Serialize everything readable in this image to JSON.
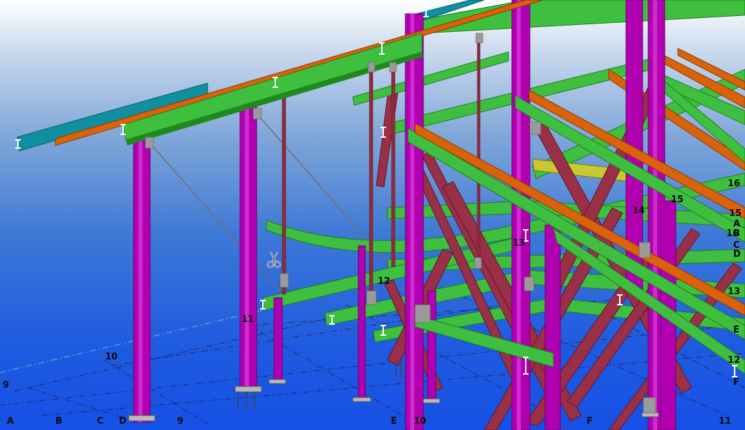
{
  "viewport": {
    "background_top": "#ffffff",
    "background_bottom": "#1650e6"
  },
  "colors": {
    "column": "#b000b0",
    "column_edge": "#6a006a",
    "beam": "#3fbf3f",
    "beam_edge": "#1e7a1e",
    "purlin": "#d9620a",
    "brace": "#9a2f48",
    "rod": "#8c2c3c",
    "teal": "#0f8fa0",
    "grid_line": "#1a1a40"
  },
  "icons": {
    "cursor": "scissors-icon"
  },
  "grid_labels": {
    "a_bottom": "A",
    "b_bottom": "B",
    "c_bottom": "C",
    "d_bottom": "D",
    "e_bottom": "E",
    "f_bottom": "F",
    "nine_left": "9",
    "nine_bottom": "9",
    "ten_mid": "10",
    "ten_bottom": "10",
    "eleven_mid": "11",
    "eleven_bottom": "11",
    "twelve_mid": "12",
    "thirteen_mid": "13",
    "fourteen_mid": "14",
    "fifteen_mid": "15",
    "sixteen_right": "16",
    "fifteen_right": "15",
    "a_right": "A",
    "b_right": "B",
    "sixteen_right_small": "16",
    "c_right": "C",
    "d_right": "D",
    "thirteen_right": "13",
    "e_right": "E",
    "twelve_right": "12",
    "f_right": "F"
  }
}
